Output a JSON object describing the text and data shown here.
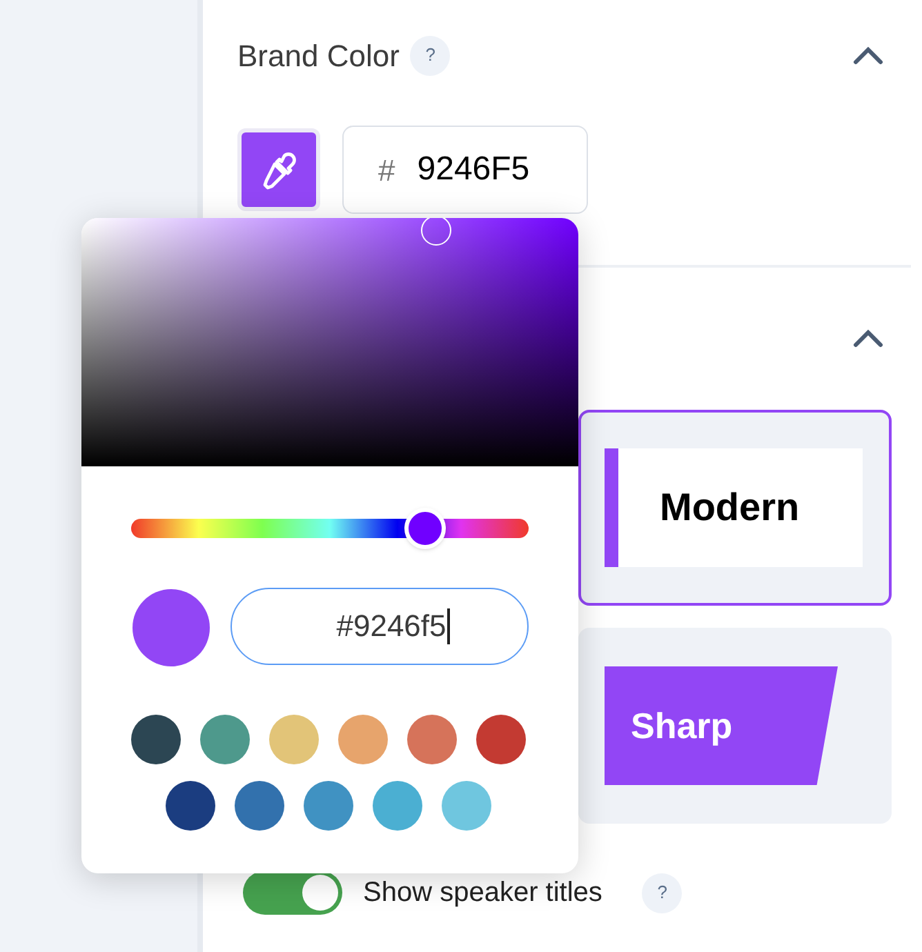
{
  "brand_color": {
    "title": "Brand Color",
    "help": "?",
    "expanded": true,
    "hex_prefix": "#",
    "hex_value": "9246F5"
  },
  "section_2": {
    "expanded": true
  },
  "color_picker": {
    "hue": {
      "level": 0.74
    },
    "hex_input": "#9246f5",
    "swatches": [
      {
        "color": "#2c4653"
      },
      {
        "color": "#4e998c"
      },
      {
        "color": "#e2c478"
      },
      {
        "color": "#e7a46c"
      },
      {
        "color": "#d6735a"
      },
      {
        "color": "#c33a32"
      },
      {
        "color": "#1b3d80"
      },
      {
        "color": "#3271ad"
      },
      {
        "color": "#4092c2"
      },
      {
        "color": "#4bafd2"
      },
      {
        "color": "#6fc6df"
      }
    ]
  },
  "styles": [
    {
      "label": "Modern",
      "kind": "modern",
      "selected": true
    },
    {
      "label": "Sharp",
      "kind": "sharp",
      "selected": false
    }
  ],
  "speaker_titles": {
    "label": "Show speaker titles",
    "on": true,
    "help": "?"
  }
}
